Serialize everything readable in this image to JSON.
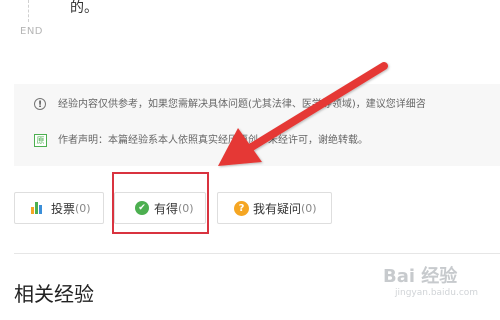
{
  "timeline": {
    "top_text": "的。",
    "end_label": "END"
  },
  "notice": {
    "disclaimer": "经验内容仅供参考，如果您需解决具体问题(尤其法律、医学等领域)，建议您详细咨",
    "disclaimer_icon": "!",
    "author_statement": "作者声明：本篇经验系本人依照真实经历原创，未经许可，谢绝转载。",
    "original_badge": "原"
  },
  "actions": {
    "vote": {
      "label": "投票",
      "count": "(0)"
    },
    "useful": {
      "label": "有得",
      "count": "(0)",
      "icon_glyph": "✔"
    },
    "question": {
      "label": "我有疑问",
      "count": "(0)",
      "icon_glyph": "?"
    }
  },
  "related": {
    "title": "相关经验"
  },
  "watermark": {
    "main": "Bai 经验",
    "sub": "jingyan.baidu.com"
  },
  "colors": {
    "annotation_red": "#d9333f",
    "check_green": "#4caf50",
    "question_orange": "#f5a623"
  }
}
